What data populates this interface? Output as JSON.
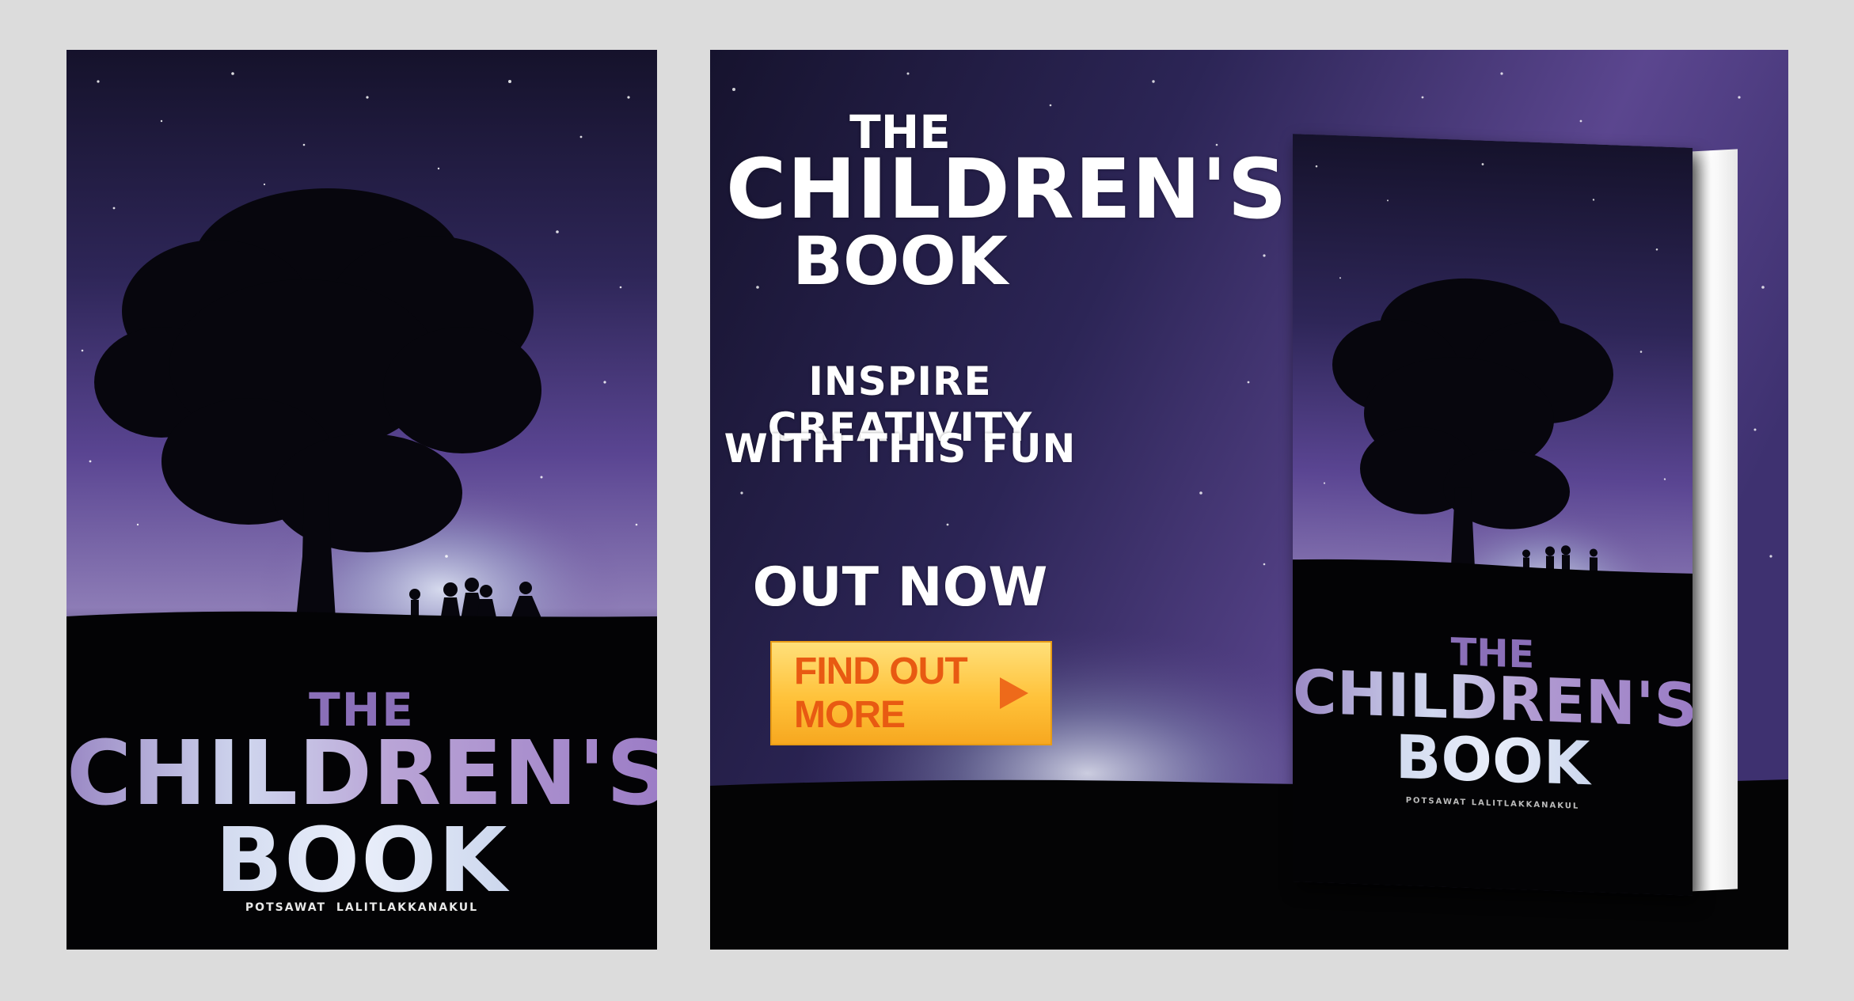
{
  "cover": {
    "title_the": "THE",
    "title_children": "CHILDREN'S",
    "title_book": "BOOK",
    "author": "POTSAWAT LALITLAKKANAKUL"
  },
  "banner": {
    "title_the": "THE",
    "title_children": "CHILDREN'S",
    "title_book": "BOOK",
    "tagline_line1": "INSPIRE CREATIVITY",
    "tagline_line2": "WITH THIS FUN",
    "out_now": "OUT NOW",
    "cta_label": "FIND OUT MORE",
    "cta_icon": "play-arrow-icon"
  },
  "book_mockup": {
    "title_the": "THE",
    "title_children": "CHILDREN'S",
    "title_book": "BOOK",
    "author": "POTSAWAT LALITLAKKANAKUL"
  },
  "colors": {
    "page_background": "#dcdcdc",
    "sky_top": "#1a1633",
    "sky_purple": "#6b4f9b",
    "glow": "#c9d4ea",
    "ground": "#000000",
    "title_purple": "#8a6fb8",
    "cta_fill": "#ffc23a",
    "cta_text": "#e85a12"
  }
}
